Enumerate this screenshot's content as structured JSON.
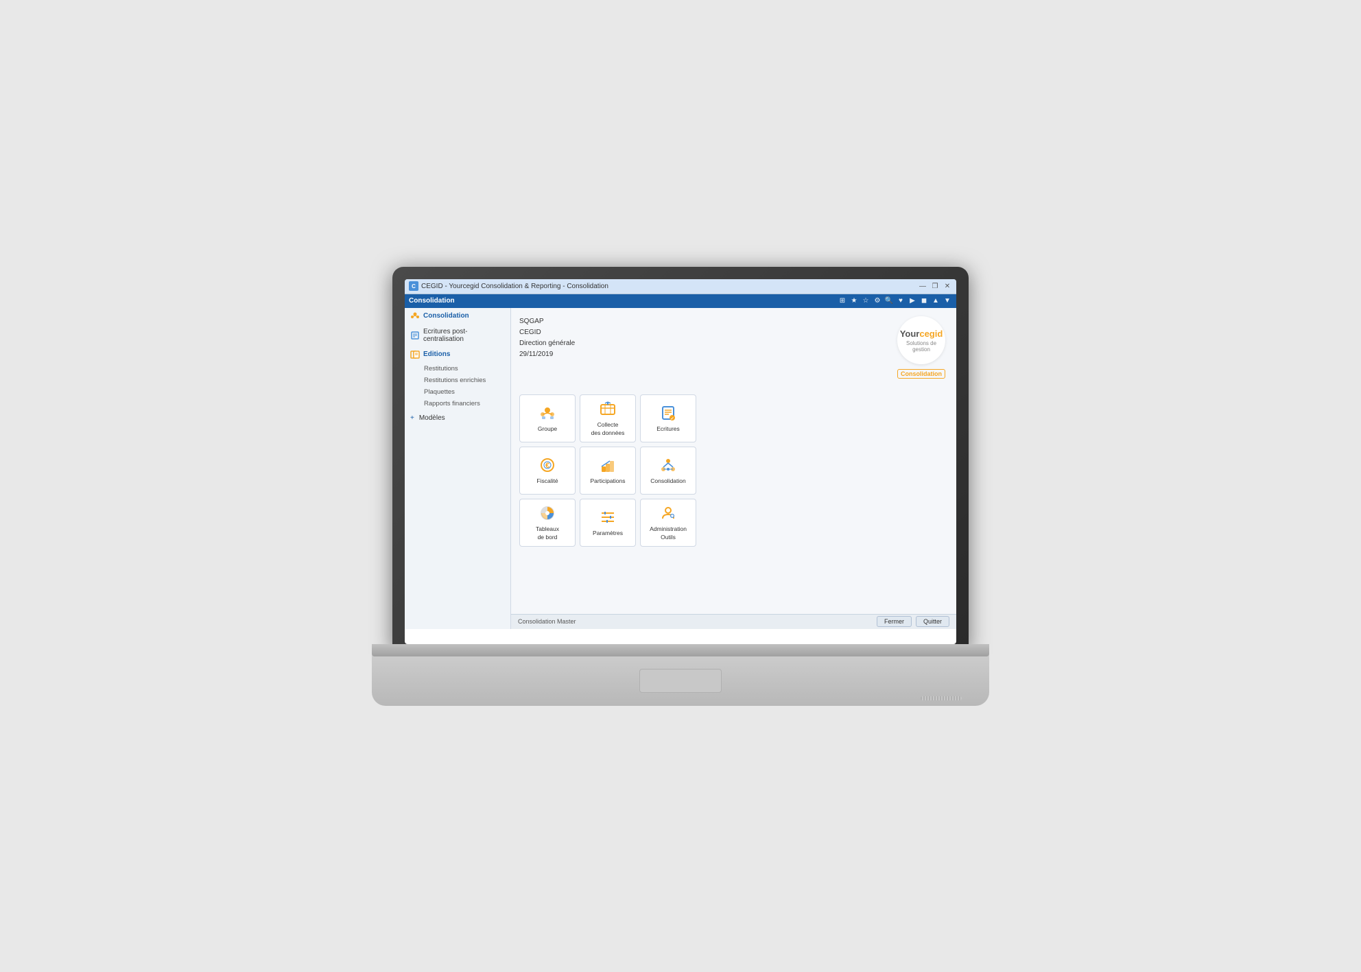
{
  "window": {
    "title": "CEGID - Yourcegid Consolidation & Reporting - Consolidation",
    "icon": "C",
    "toolbar_label": "Consolidation",
    "controls": {
      "minimize": "—",
      "restore": "❐",
      "close": "✕"
    }
  },
  "sidebar": {
    "items": [
      {
        "id": "consolidation",
        "label": "Consolidation",
        "icon": "people",
        "active": true
      },
      {
        "id": "ecritures-post-centralisation",
        "label": "Ecritures post-centralisation",
        "icon": "doc"
      },
      {
        "id": "editions",
        "label": "Editions",
        "icon": "book",
        "active": true,
        "expanded": true
      }
    ],
    "subitems": [
      {
        "id": "restitutions",
        "label": "Restitutions"
      },
      {
        "id": "restitutions-enrichies",
        "label": "Restitutions enrichies"
      },
      {
        "id": "plaquettes",
        "label": "Plaquettes"
      },
      {
        "id": "rapports-financiers",
        "label": "Rapports financiers"
      }
    ],
    "modeles": {
      "label": "Modèles",
      "icon": "expand"
    }
  },
  "info": {
    "line1": "SQGAP",
    "line2": "CEGID",
    "line3": "Direction générale",
    "line4": "29/11/2019"
  },
  "logo": {
    "your": "Your",
    "cegid": "cegid",
    "subtitle": "Solutions de gestion",
    "badge": "Consolidation"
  },
  "modules": [
    {
      "id": "groupe",
      "label": "Groupe",
      "icon": "group"
    },
    {
      "id": "collecte-des-donnees",
      "label": "Collecte\ndes données",
      "icon": "collecte"
    },
    {
      "id": "ecritures",
      "label": "Ecritures",
      "icon": "ecritures"
    },
    {
      "id": "fiscalite",
      "label": "Fiscalité",
      "icon": "fiscalite"
    },
    {
      "id": "participations",
      "label": "Participations",
      "icon": "participations"
    },
    {
      "id": "consolidation",
      "label": "Consolidation",
      "icon": "consolidation"
    },
    {
      "id": "tableaux-de-bord",
      "label": "Tableaux\nde bord",
      "icon": "tableaux"
    },
    {
      "id": "parametres",
      "label": "Paramètres",
      "icon": "parametres"
    },
    {
      "id": "administration-outils",
      "label": "Administration\nOutils",
      "icon": "admin"
    }
  ],
  "status": {
    "text": "Consolidation Master"
  },
  "buttons": {
    "fermer": "Fermer",
    "quitter": "Quitter"
  },
  "toolbar_icons": [
    "⊞",
    "★",
    "☆",
    "⚙",
    "🔍",
    "♥",
    "▶",
    "◼",
    "▲",
    "▼"
  ]
}
